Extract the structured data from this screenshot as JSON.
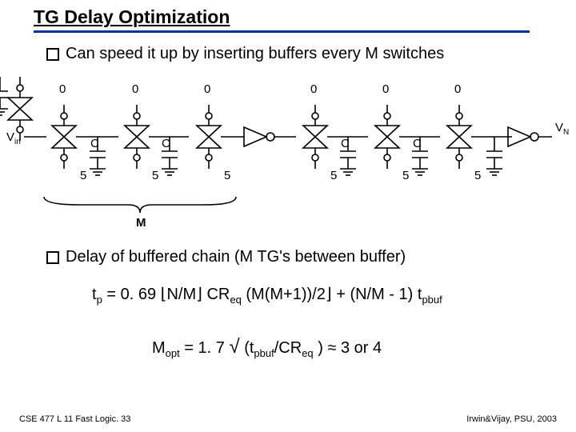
{
  "title": "TG Delay Optimization",
  "bullets": [
    "Can speed it up by inserting buffers every M switches",
    "Delay of buffered chain (M TG's between buffer)"
  ],
  "labels": {
    "Vin": "V",
    "in": "in",
    "VN": "V",
    "N": "N",
    "zero": "0",
    "five": "5",
    "C": "C",
    "M": "M"
  },
  "eq1": {
    "tp": "t",
    "p": "p",
    "eq": " = 0. 69 ",
    "lfloor": "⌊",
    "nm": "N/M",
    "rfloor": "⌋ ",
    "CR": "CR",
    "eqsub": "eq",
    "mid": " (M(M+1))/2",
    "plus": " + (N/M - 1) t",
    "pbuf": "pbuf"
  },
  "eq2": {
    "M": "M",
    "opt": "opt",
    "eq": " = 1. 7 ",
    "sqrt": "√",
    "open": " (t",
    "pbuf": "pbuf",
    "slash": "/CR",
    "eqsub": "eq",
    "close": " ) ",
    "approx": "≈",
    "tail": " 3 or 4"
  },
  "footer_left": "CSE 477 L 11 Fast Logic. 33",
  "footer_right": "Irwin&Vijay, PSU, 2003"
}
